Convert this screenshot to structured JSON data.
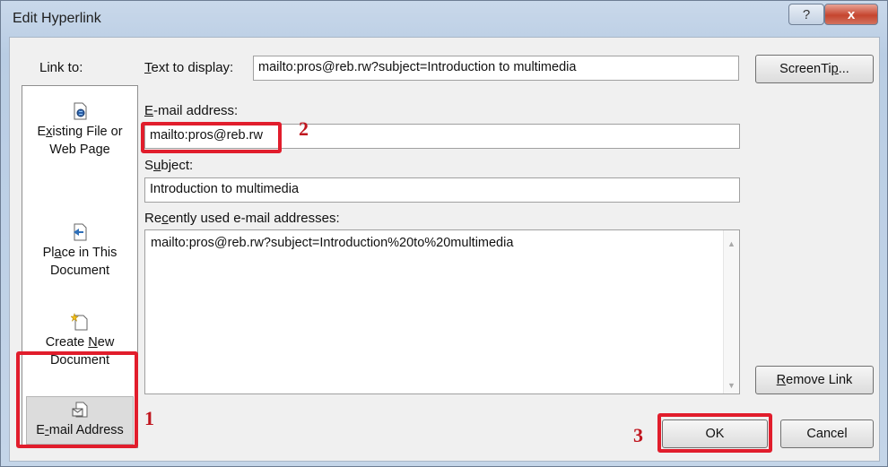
{
  "window": {
    "title": "Edit Hyperlink",
    "help_glyph": "?",
    "close_glyph": "x"
  },
  "sidebar": {
    "label": "Link to:",
    "items": [
      {
        "line1_pre": "E",
        "line1_u": "x",
        "line1_post": "isting File or",
        "line2": "Web Page"
      },
      {
        "line1_pre": "Pl",
        "line1_u": "a",
        "line1_post": "ce in This",
        "line2": "Document"
      },
      {
        "line1": "Create ",
        "line1_u": "N",
        "line1_post": "ew",
        "line2": "Document"
      },
      {
        "pre": "E",
        "u": "-",
        "post": "mail Address"
      }
    ]
  },
  "form": {
    "text_to_display": {
      "label_u": "T",
      "label_rest": "ext to display:",
      "value": "mailto:pros@reb.rw?subject=Introduction to multimedia"
    },
    "email": {
      "label_u": "E",
      "label_rest": "-mail address:",
      "value": "mailto:pros@reb.rw"
    },
    "subject": {
      "label_pre": "S",
      "label_u": "u",
      "label_rest": "bject:",
      "value": "Introduction to multimedia"
    },
    "recent": {
      "label_pre": "Re",
      "label_u": "c",
      "label_rest": "ently used e-mail addresses:",
      "items": [
        "mailto:pros@reb.rw?subject=Introduction%20to%20multimedia"
      ]
    }
  },
  "buttons": {
    "screentip": {
      "pre": "ScreenTi",
      "u": "p",
      "post": "..."
    },
    "remove_link": {
      "u": "R",
      "post": "emove Link"
    },
    "ok": "OK",
    "cancel": "Cancel"
  },
  "annotations": [
    "1",
    "2",
    "3"
  ],
  "colors": {
    "annotation": "#e11d2c"
  }
}
